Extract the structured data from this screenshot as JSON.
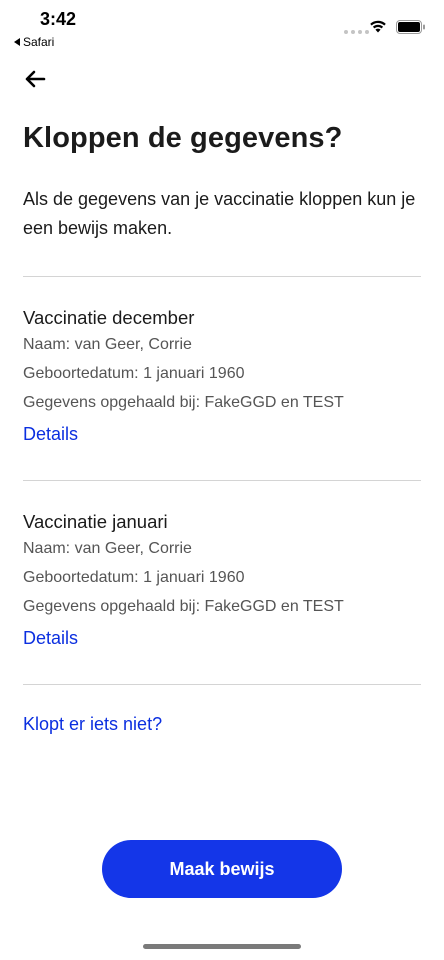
{
  "status_bar": {
    "time": "3:42",
    "back_app": "Safari",
    "icons": [
      "signal-dots-icon",
      "wifi-icon",
      "battery-icon"
    ]
  },
  "nav": {
    "back_icon": "arrow-left-icon"
  },
  "page": {
    "title": "Kloppen de gegevens?",
    "intro": "Als de gegevens van je vaccinatie kloppen kun je een bewijs maken."
  },
  "vaccinations": [
    {
      "title": "Vaccinatie december",
      "name": "Naam: van Geer, Corrie",
      "birthdate": "Geboortedatum: 1 januari 1960",
      "source": "Gegevens opgehaald bij: FakeGGD en TEST",
      "details_label": "Details"
    },
    {
      "title": "Vaccinatie januari",
      "name": "Naam: van Geer, Corrie",
      "birthdate": "Geboortedatum: 1 januari 1960",
      "source": "Gegevens opgehaald bij: FakeGGD en TEST",
      "details_label": "Details"
    }
  ],
  "problem_link": "Klopt er iets niet?",
  "primary_button": "Maak bewijs",
  "colors": {
    "accent": "#1436e8",
    "link": "#0b2fe0",
    "text": "#1b1b1b",
    "secondary_text": "#555555",
    "divider": "#d4d4d4"
  }
}
